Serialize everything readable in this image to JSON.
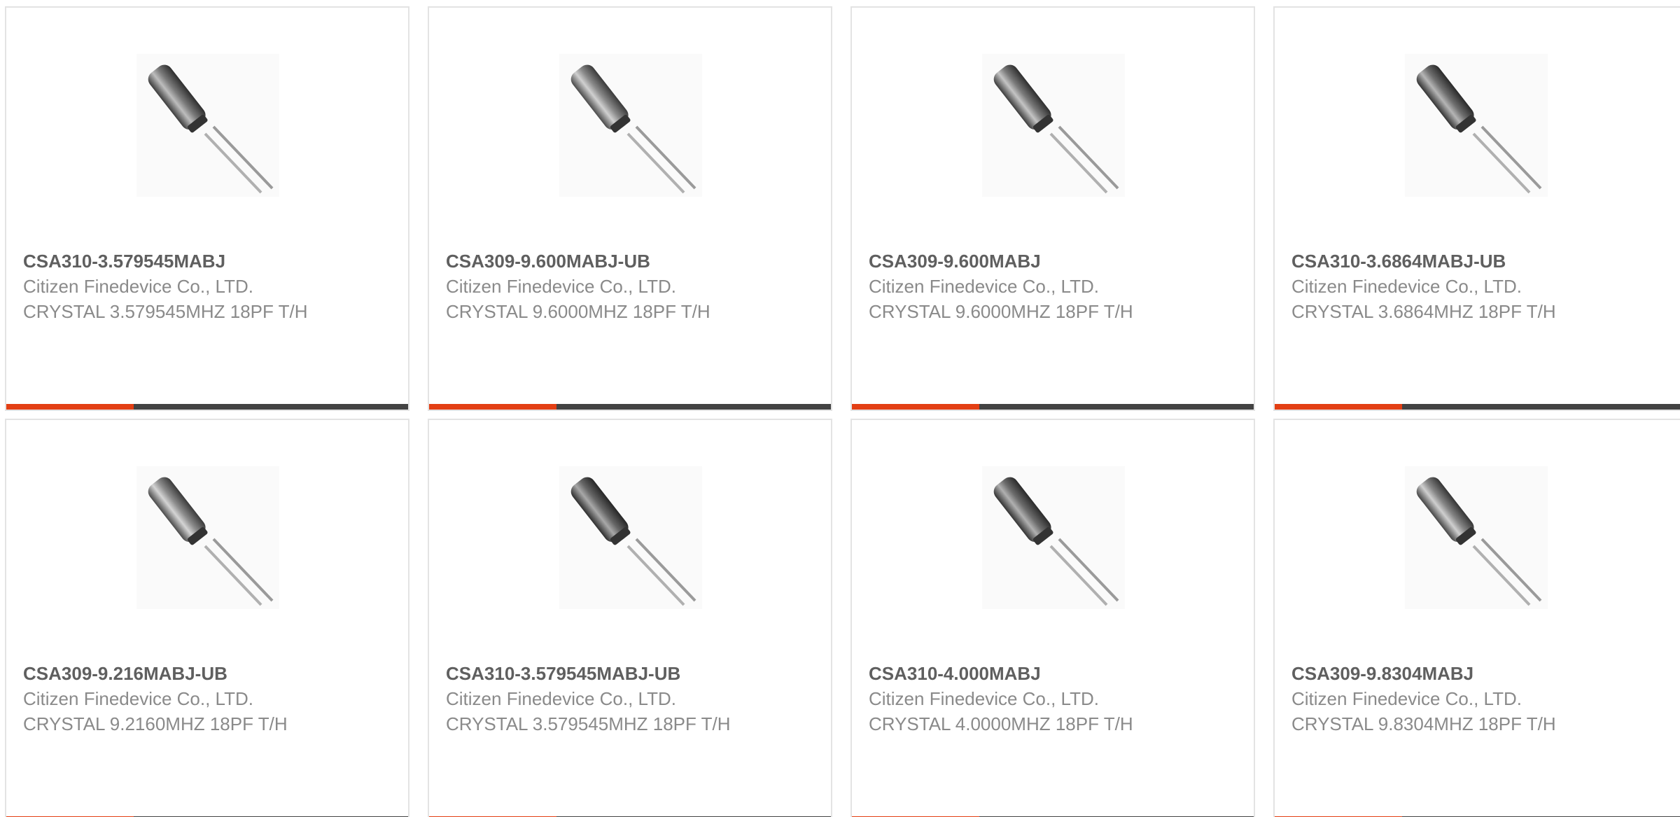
{
  "colors": {
    "accent": "#e33f14",
    "bar_dark": "#434343",
    "part_text": "#5f5f5f",
    "secondary_text": "#8a8a8a",
    "card_border": "#e3e3e3"
  },
  "product_image_icon": "crystal-oscillator-icon",
  "products": [
    {
      "part_number": "CSA310-3.579545MABJ",
      "manufacturer": "Citizen Finedevice Co., LTD.",
      "description": "CRYSTAL 3.579545MHZ 18PF T/H"
    },
    {
      "part_number": "CSA309-9.600MABJ-UB",
      "manufacturer": "Citizen Finedevice Co., LTD.",
      "description": "CRYSTAL 9.6000MHZ 18PF T/H"
    },
    {
      "part_number": "CSA309-9.600MABJ",
      "manufacturer": "Citizen Finedevice Co., LTD.",
      "description": "CRYSTAL 9.6000MHZ 18PF T/H"
    },
    {
      "part_number": "CSA310-3.6864MABJ-UB",
      "manufacturer": "Citizen Finedevice Co., LTD.",
      "description": "CRYSTAL 3.6864MHZ 18PF T/H"
    },
    {
      "part_number": "CSA309-9.216MABJ-UB",
      "manufacturer": "Citizen Finedevice Co., LTD.",
      "description": "CRYSTAL 9.2160MHZ 18PF T/H"
    },
    {
      "part_number": "CSA310-3.579545MABJ-UB",
      "manufacturer": "Citizen Finedevice Co., LTD.",
      "description": "CRYSTAL 3.579545MHZ 18PF T/H"
    },
    {
      "part_number": "CSA310-4.000MABJ",
      "manufacturer": "Citizen Finedevice Co., LTD.",
      "description": "CRYSTAL 4.0000MHZ 18PF T/H"
    },
    {
      "part_number": "CSA309-9.8304MABJ",
      "manufacturer": "Citizen Finedevice Co., LTD.",
      "description": "CRYSTAL 9.8304MHZ 18PF T/H"
    }
  ]
}
